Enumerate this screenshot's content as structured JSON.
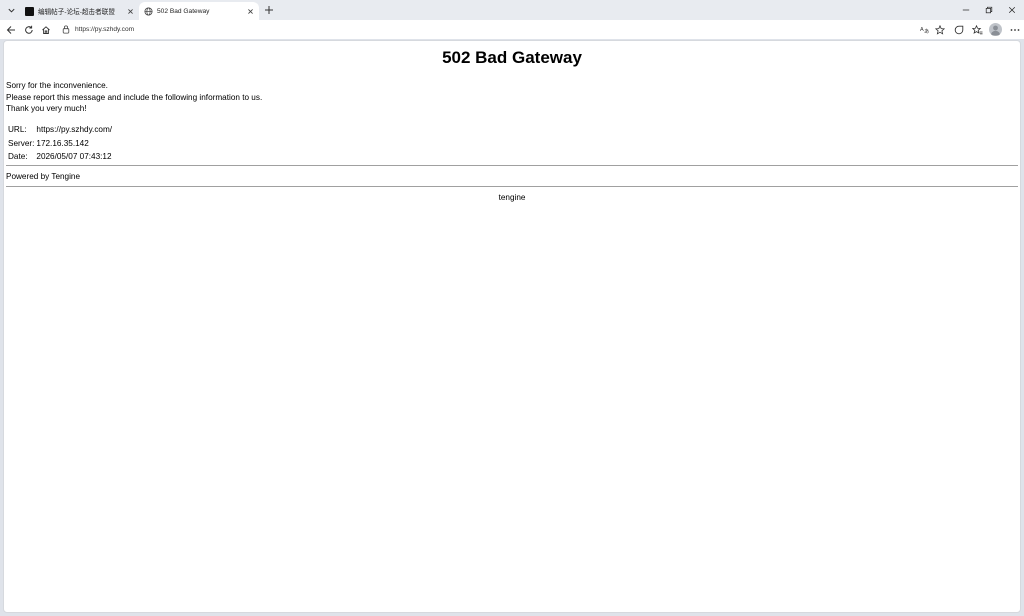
{
  "browser": {
    "tabs": [
      {
        "title": "编辑帖子-论坛-超击者联盟",
        "active": false,
        "favicon": "black-square-icon"
      },
      {
        "title": "502 Bad Gateway",
        "active": true,
        "favicon": "globe-icon"
      }
    ],
    "address": "https://py.szhdy.com",
    "toolbar_icons": [
      "back-arrow-icon",
      "reload-icon",
      "home-icon",
      "site-info-icon",
      "translate-icon",
      "favorite-star-icon",
      "extensions-icon",
      "favorites-list-icon",
      "profile-avatar-icon",
      "more-menu-icon"
    ]
  },
  "page": {
    "heading": "502 Bad Gateway",
    "message_lines": [
      "Sorry for the inconvenience.",
      "Please report this message and include the following information to us.",
      "Thank you very much!"
    ],
    "info": [
      {
        "key": "URL:",
        "value": "https://py.szhdy.com/"
      },
      {
        "key": "Server:",
        "value": "172.16.35.142"
      },
      {
        "key": "Date:",
        "value": "2026/05/07 07:43:12"
      }
    ],
    "powered_by": "Powered by Tengine",
    "footer": "tengine"
  }
}
